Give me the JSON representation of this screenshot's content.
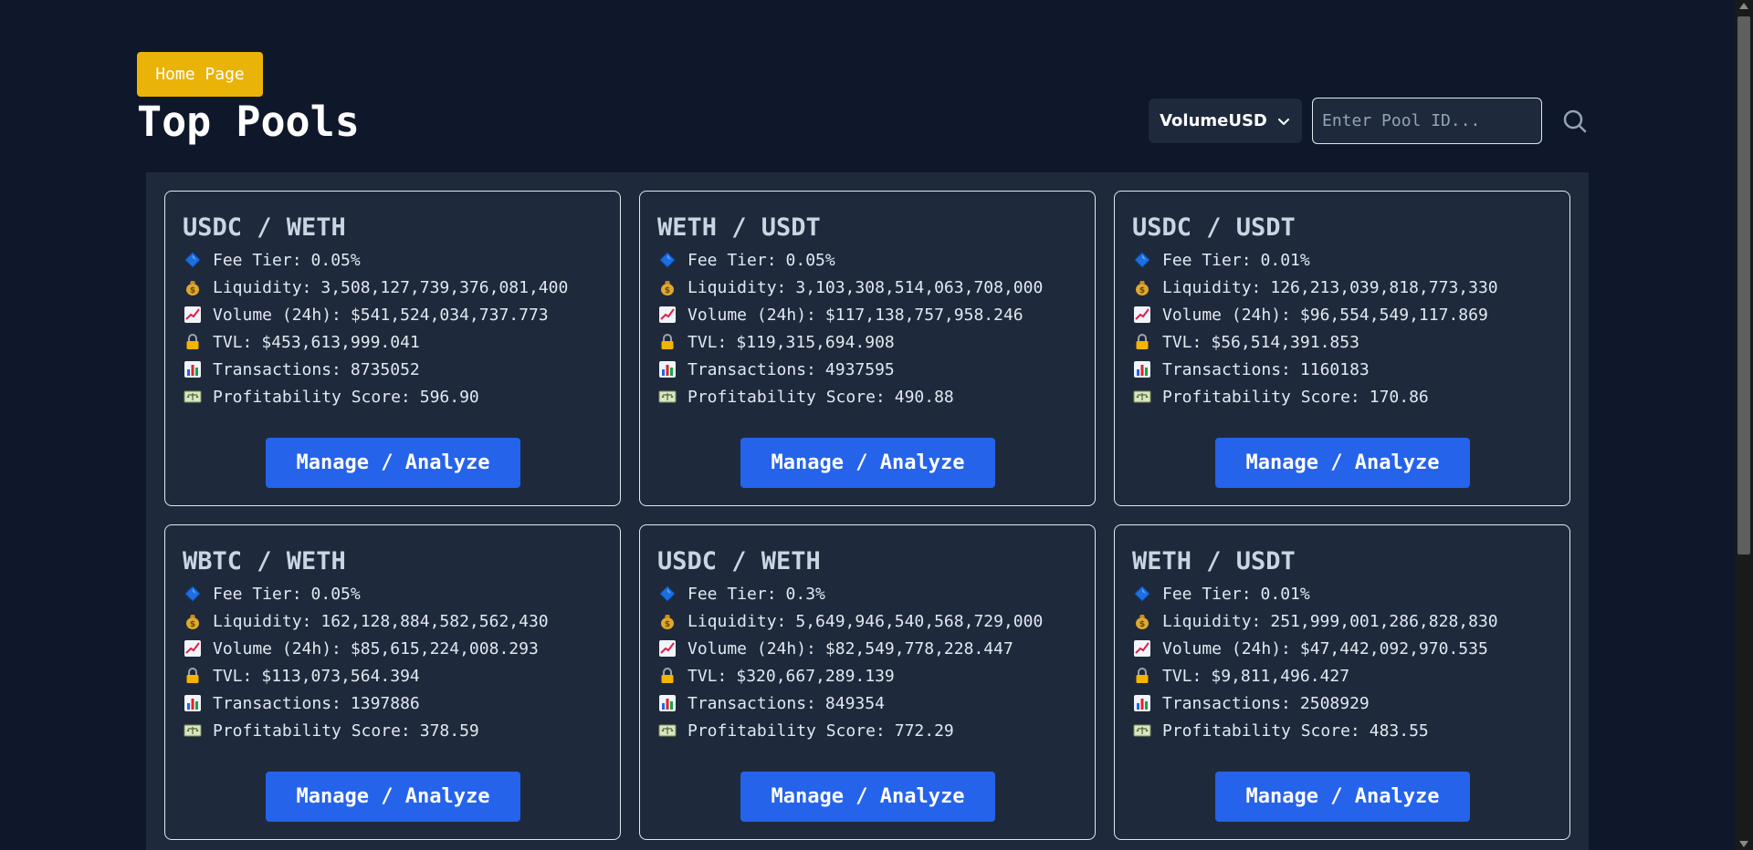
{
  "header": {
    "home_label": "Home Page",
    "title": "Top Pools"
  },
  "controls": {
    "sort_value": "VolumeUSD",
    "search_placeholder": "Enter Pool ID..."
  },
  "labels": {
    "fee_tier": "Fee Tier:",
    "liquidity": "Liquidity:",
    "volume": "Volume (24h):",
    "tvl": "TVL:",
    "transactions": "Transactions:",
    "profitability": "Profitability Score:",
    "manage_button": "Manage / Analyze"
  },
  "icons": {
    "fee_tier": "diamond-icon",
    "liquidity": "money-bag-icon",
    "volume": "chart-increasing-icon",
    "tvl": "lock-icon",
    "transactions": "bar-chart-icon",
    "profitability": "balance-scale-icon"
  },
  "colors": {
    "background": "#0f172a",
    "panel": "#1e293b",
    "home_button": "#eab308",
    "manage_button": "#2563eb"
  },
  "pools": [
    {
      "pair": "USDC / WETH",
      "fee_tier": "0.05%",
      "liquidity": "3,508,127,739,376,081,400",
      "volume": "$541,524,034,737.773",
      "tvl": "$453,613,999.041",
      "transactions": "8735052",
      "profitability": "596.90"
    },
    {
      "pair": "WETH / USDT",
      "fee_tier": "0.05%",
      "liquidity": "3,103,308,514,063,708,000",
      "volume": "$117,138,757,958.246",
      "tvl": "$119,315,694.908",
      "transactions": "4937595",
      "profitability": "490.88"
    },
    {
      "pair": "USDC / USDT",
      "fee_tier": "0.01%",
      "liquidity": "126,213,039,818,773,330",
      "volume": "$96,554,549,117.869",
      "tvl": "$56,514,391.853",
      "transactions": "1160183",
      "profitability": "170.86"
    },
    {
      "pair": "WBTC / WETH",
      "fee_tier": "0.05%",
      "liquidity": "162,128,884,582,562,430",
      "volume": "$85,615,224,008.293",
      "tvl": "$113,073,564.394",
      "transactions": "1397886",
      "profitability": "378.59"
    },
    {
      "pair": "USDC / WETH",
      "fee_tier": "0.3%",
      "liquidity": "5,649,946,540,568,729,000",
      "volume": "$82,549,778,228.447",
      "tvl": "$320,667,289.139",
      "transactions": "849354",
      "profitability": "772.29"
    },
    {
      "pair": "WETH / USDT",
      "fee_tier": "0.01%",
      "liquidity": "251,999,001,286,828,830",
      "volume": "$47,442,092,970.535",
      "tvl": "$9,811,496.427",
      "transactions": "2508929",
      "profitability": "483.55"
    }
  ]
}
